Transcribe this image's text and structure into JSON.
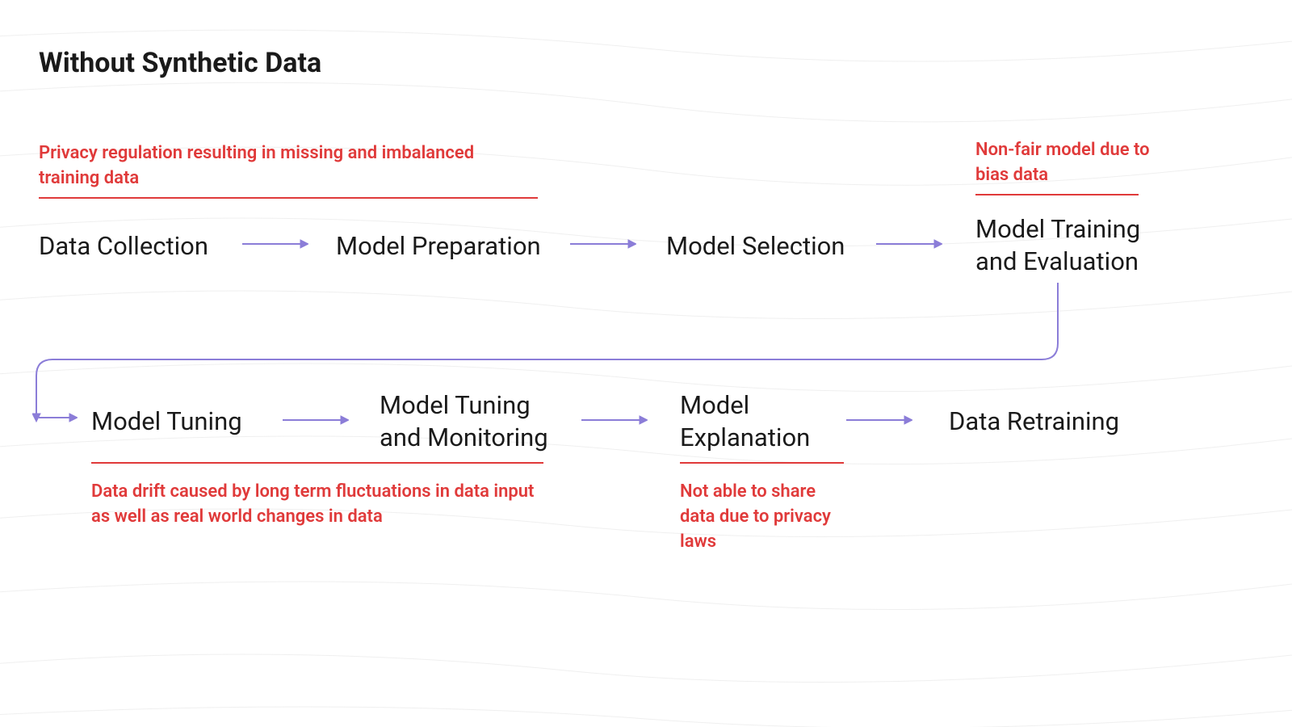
{
  "title": "Without Synthetic Data",
  "annotations": {
    "privacy_regulation": "Privacy regulation resulting in missing and imbalanced training data",
    "non_fair": "Non-fair model due to bias data",
    "data_drift": "Data drift caused by long term fluctuations in data input as well as real world changes in data",
    "not_able_share": "Not able to share data due to privacy laws"
  },
  "stages": {
    "data_collection": "Data Collection",
    "model_preparation": "Model Preparation",
    "model_selection": "Model Selection",
    "model_training_eval": "Model Training and Evaluation",
    "model_tuning": "Model Tuning",
    "model_tuning_monitoring": "Model Tuning and Monitoring",
    "model_explanation": "Model Explanation",
    "data_retraining": "Data Retraining"
  },
  "colors": {
    "arrow": "#8b7dd8",
    "annotation": "#e03a3a",
    "text": "#1a1a1a"
  }
}
